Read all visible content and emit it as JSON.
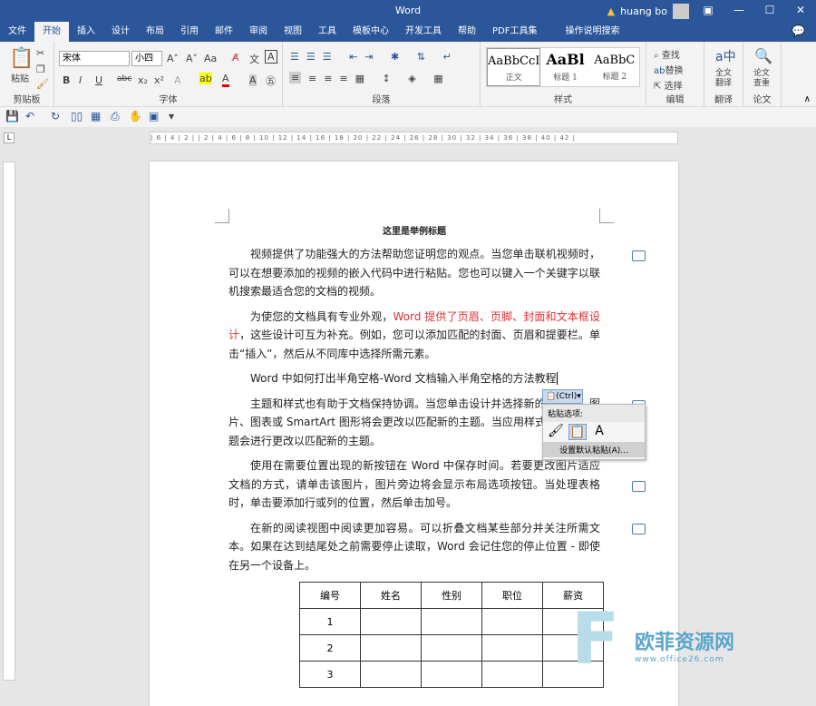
{
  "app": {
    "title": "Word",
    "user": "huang bo"
  },
  "tabs": [
    "文件",
    "开始",
    "插入",
    "设计",
    "布局",
    "引用",
    "邮件",
    "审阅",
    "视图",
    "工具",
    "模板中心",
    "开发工具",
    "帮助",
    "PDF工具集",
    "操作说明搜索"
  ],
  "ribbon": {
    "clipboard": {
      "paste": "粘贴",
      "label": "剪贴板"
    },
    "font": {
      "name": "宋体",
      "size": "小四",
      "label": "字体"
    },
    "paragraph": {
      "label": "段落"
    },
    "styles": {
      "items": [
        {
          "preview": "AaBbCcI",
          "name": "正文"
        },
        {
          "preview": "AaBl",
          "name": "标题 1"
        },
        {
          "preview": "AaBbC",
          "name": "标题 2"
        }
      ],
      "label": "样式"
    },
    "editing": {
      "find": "查找",
      "replace": "替换",
      "select": "选择",
      "label": "编辑"
    },
    "translate": {
      "btn": "全文翻译",
      "label": "翻译"
    },
    "paper": {
      "btn": "论文查重",
      "label": "论文"
    }
  },
  "ruler": "| 6 | 4 | 2 |   | 2 | 4 | 6 | 8 | 10 | 12 | 14 | 16 | 18 | 20 | 22 | 24 | 26 | 28 | 30 | 32 | 34 | 36 | 38 | 40 | 42 |",
  "document": {
    "title": "这里是举例标题",
    "p1": "视频提供了功能强大的方法帮助您证明您的观点。当您单击联机视频时，可以在想要添加的视频的嵌入代码中进行粘贴。您也可以键入一个关键字以联机搜索最适合您的文档的视频。",
    "p2a": "为使您的文档具有专业外观，",
    "p2red": "Word 提供了页眉、页脚、封面和文本框设计",
    "p2b": "，这些设计可互为补充。例如，您可以添加匹配的封面、页眉和提要栏。单击“插入”，然后从不同库中选择所需元素。",
    "p3": "Word 中如何打出半角空格-Word 文档输入半角空格的方法教程",
    "p4": "主题和样式也有助于文档保持协调。当您单击设计并选择新的主题时，图片、图表或 SmartArt 图形将会更改以匹配新的主题。当应用样式时，您的标题会进行更改以匹配新的主题。",
    "p5": "使用在需要位置出现的新按钮在 Word 中保存时间。若要更改图片适应文档的方式，请单击该图片，图片旁边将会显示布局选项按钮。当处理表格时，单击要添加行或列的位置，然后单击加号。",
    "p6": "在新的阅读视图中阅读更加容易。可以折叠文档某些部分并关注所需文本。如果在达到结尾处之前需要停止读取，Word 会记住您的停止位置 - 即使在另一个设备上。",
    "table": {
      "headers": [
        "编号",
        "姓名",
        "性别",
        "职位",
        "薪资"
      ],
      "rows": [
        [
          "1",
          "",
          "",
          "",
          ""
        ],
        [
          "2",
          "",
          "",
          "",
          ""
        ],
        [
          "3",
          "",
          "",
          "",
          ""
        ]
      ]
    }
  },
  "paste": {
    "button": "(Ctrl)▾",
    "header": "粘贴选项:",
    "default": "设置默认粘贴(A)..."
  },
  "watermark": {
    "name": "欧菲资源网",
    "url": "www.office26.com"
  }
}
